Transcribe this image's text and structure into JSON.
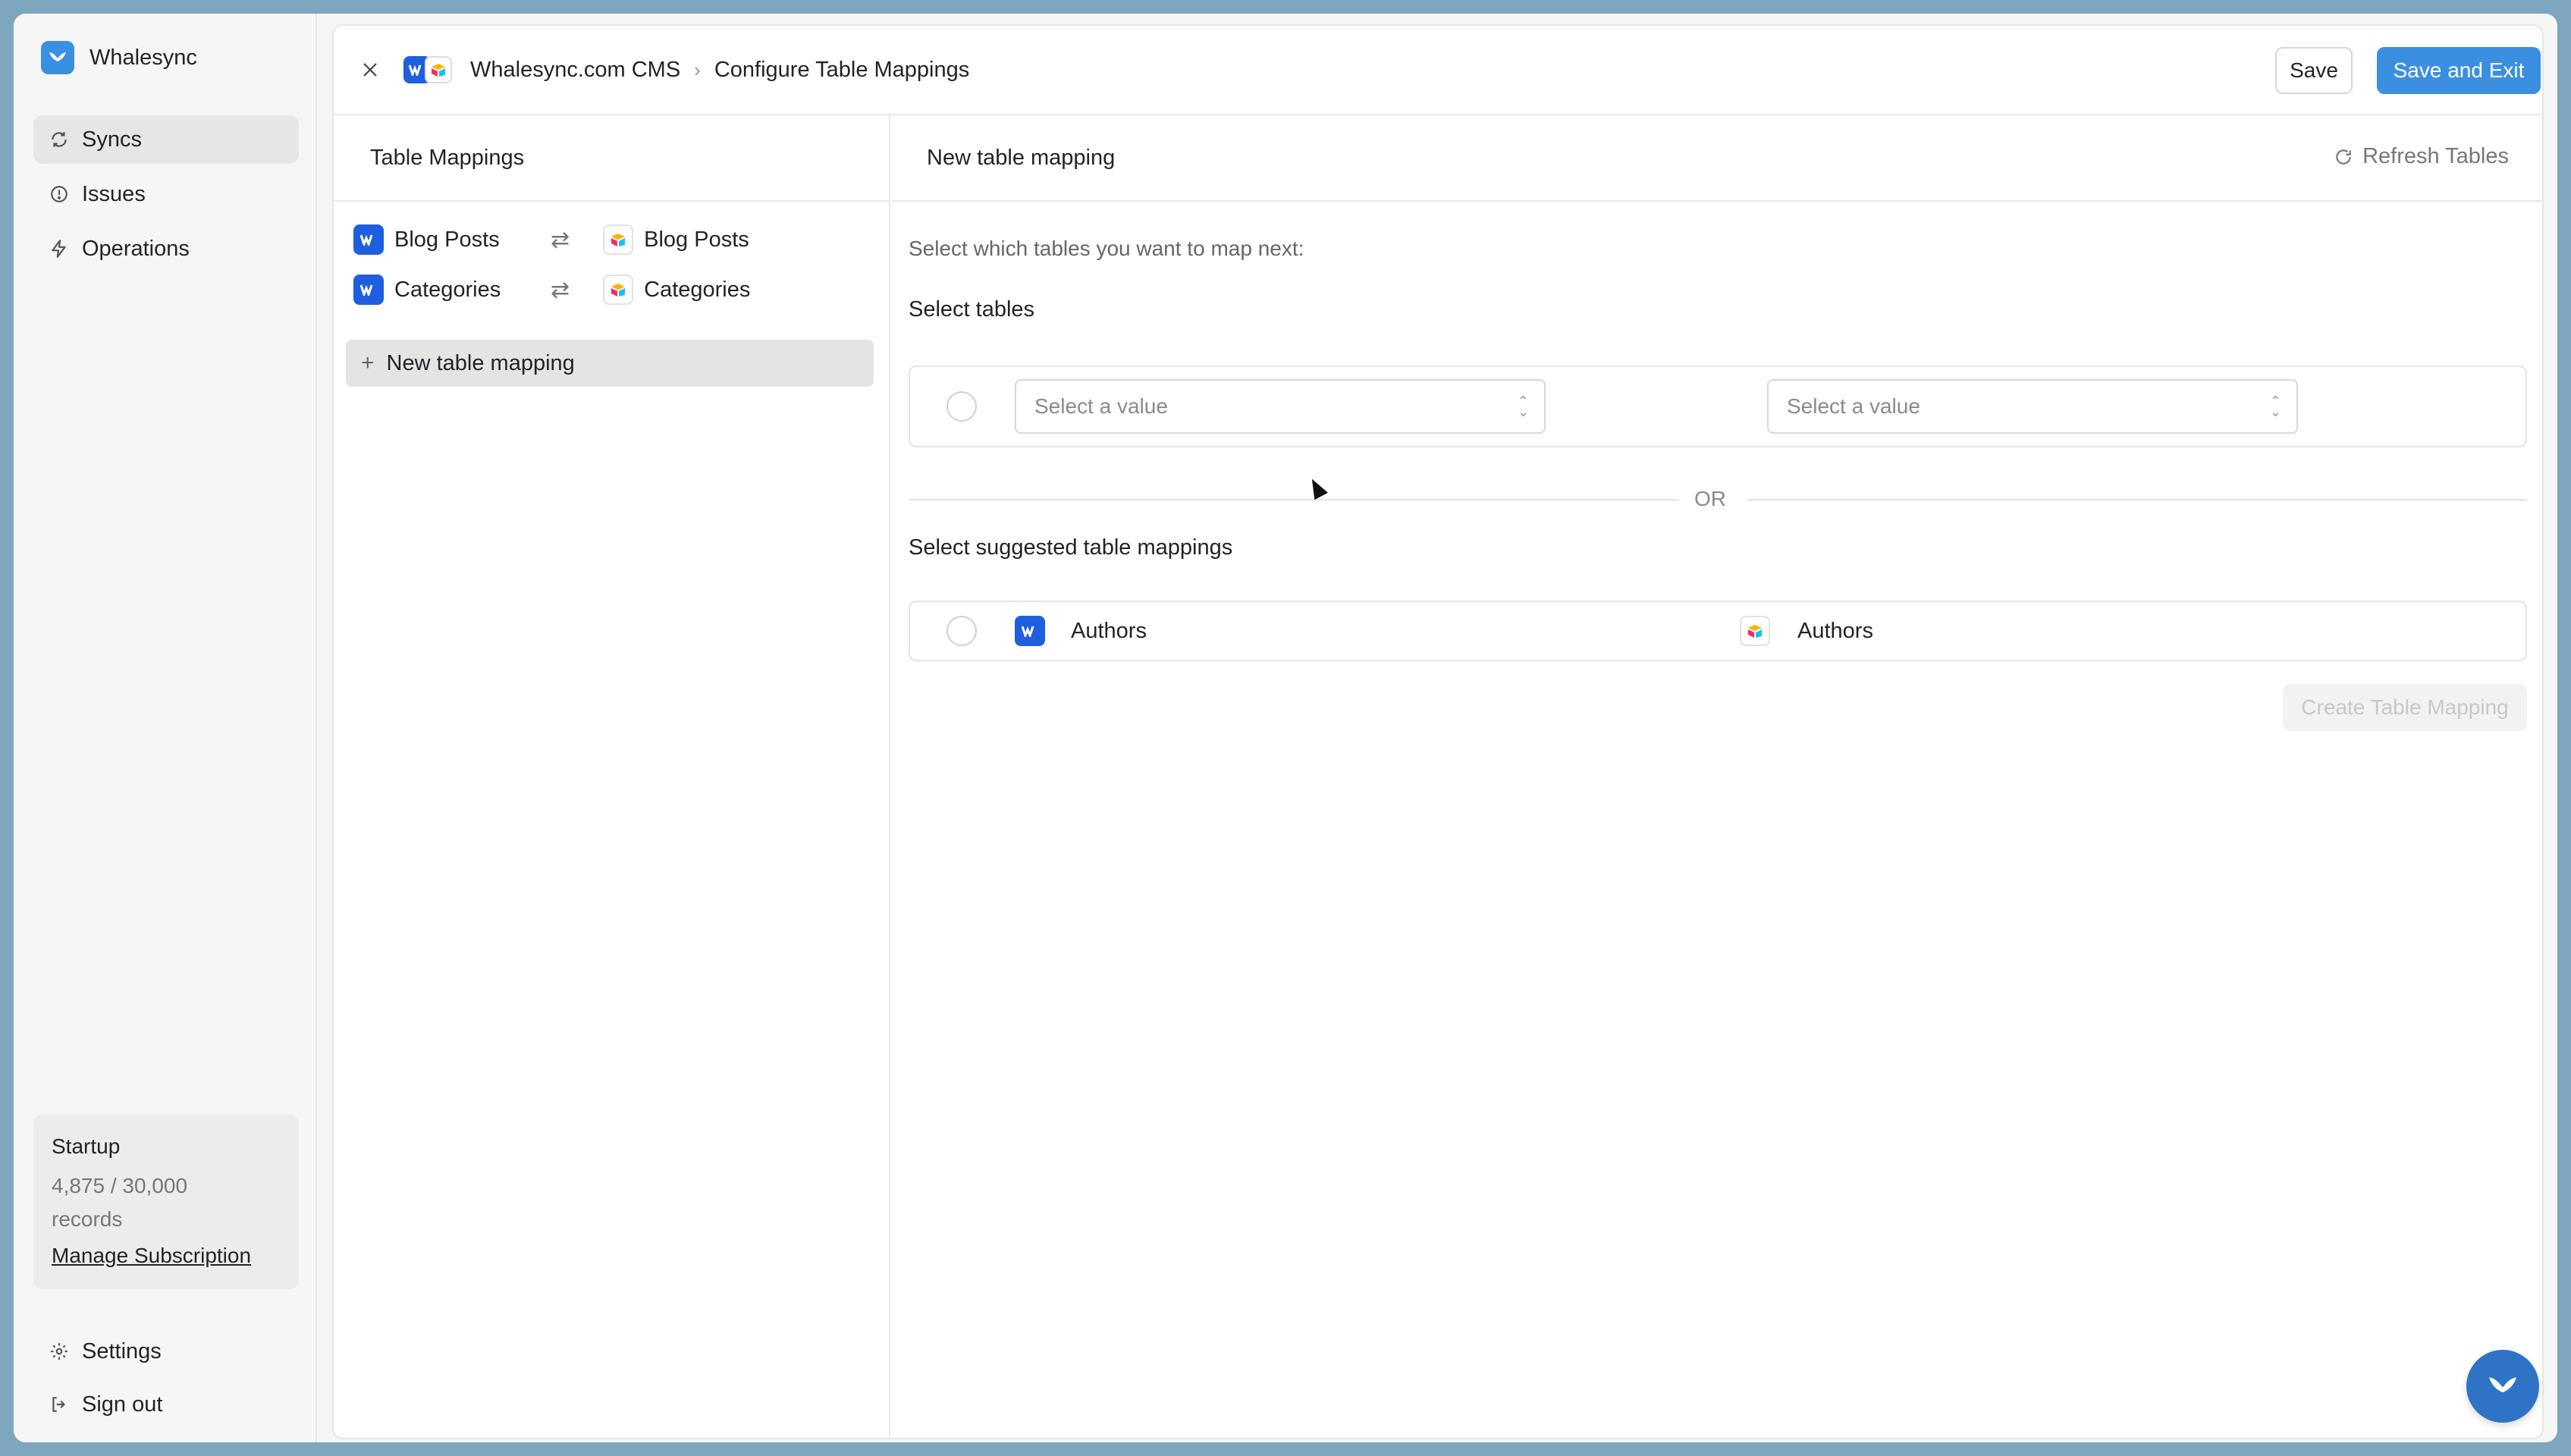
{
  "brand": {
    "name": "Whalesync",
    "logo_icon": "whale-tail-icon"
  },
  "sidebar": {
    "items": [
      {
        "label": "Syncs",
        "icon": "sync-icon",
        "active": true
      },
      {
        "label": "Issues",
        "icon": "alert-circle-icon",
        "active": false
      },
      {
        "label": "Operations",
        "icon": "bolt-icon",
        "active": false
      }
    ],
    "plan": {
      "name": "Startup",
      "usage": "4,875 / 30,000",
      "usage_unit": "records",
      "manage_label": "Manage Subscription"
    },
    "bottom": [
      {
        "label": "Settings",
        "icon": "gear-icon"
      },
      {
        "label": "Sign out",
        "icon": "sign-out-icon"
      }
    ]
  },
  "header": {
    "sync_name": "Whalesync.com CMS",
    "page": "Configure Table Mappings",
    "save_label": "Save",
    "save_exit_label": "Save and Exit"
  },
  "left": {
    "title": "Table Mappings",
    "mappings": [
      {
        "source": "Blog Posts",
        "target": "Blog Posts"
      },
      {
        "source": "Categories",
        "target": "Categories"
      }
    ],
    "new_mapping_label": "New table mapping"
  },
  "right": {
    "title": "New table mapping",
    "refresh_label": "Refresh Tables",
    "hint": "Select which tables you want to map next:",
    "select_tables_title": "Select tables",
    "select_placeholder_left": "Select a value",
    "select_placeholder_right": "Select a value",
    "or_label": "OR",
    "suggested_title": "Select suggested table mappings",
    "suggested": [
      {
        "source": "Authors",
        "target": "Authors"
      }
    ],
    "create_label": "Create Table Mapping"
  },
  "colors": {
    "accent": "#3b8fe0",
    "webflow": "#1e5fe0",
    "background": "#7ea6bf"
  }
}
